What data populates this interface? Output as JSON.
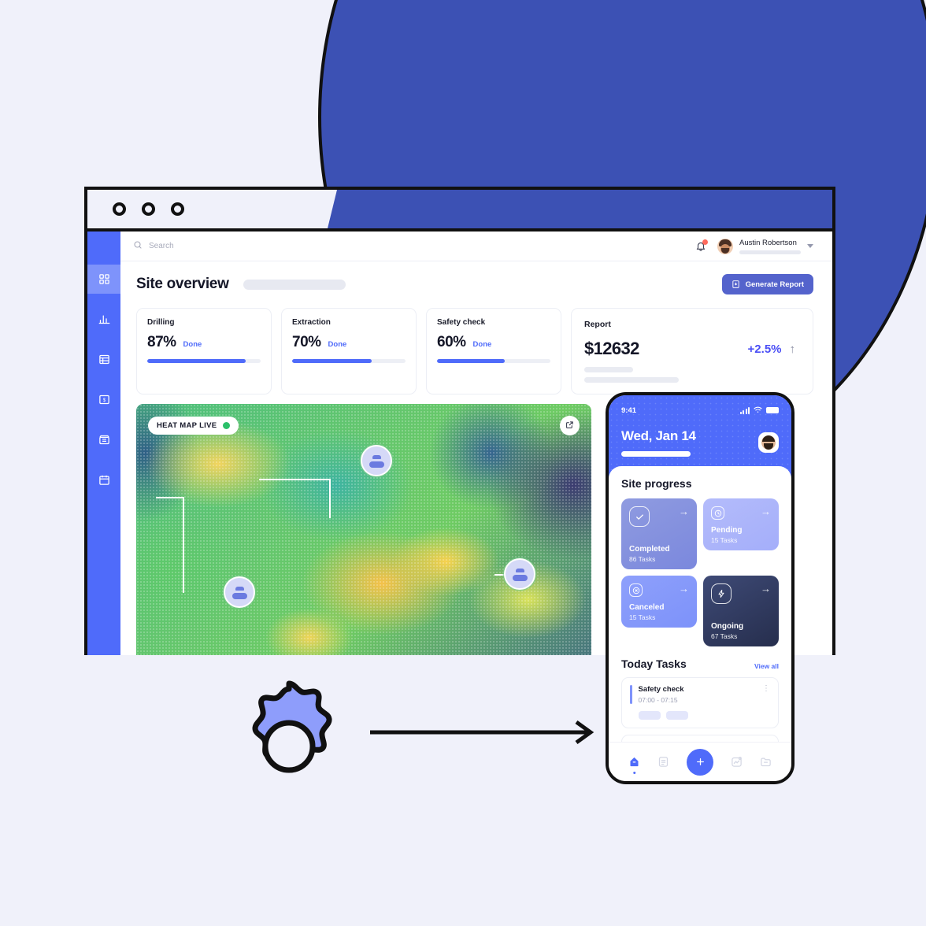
{
  "theme": {
    "brand_blue": "#4f6bfa",
    "deep_blue": "#3c51b4",
    "button_blue": "#5463cc",
    "page_bg": "#f0f1fa",
    "live_green": "#2bc06a",
    "notification_red": "#ff6b5e",
    "delta_blue": "#4a4ef5"
  },
  "browser": {
    "dots": [
      "window-dot-1",
      "window-dot-2",
      "window-dot-3"
    ]
  },
  "sidebar": {
    "items": [
      {
        "name": "dashboard",
        "icon": "grid-icon",
        "active": true
      },
      {
        "name": "analytics",
        "icon": "bar-chart-icon",
        "active": false
      },
      {
        "name": "table",
        "icon": "table-icon",
        "active": false
      },
      {
        "name": "billing",
        "icon": "money-doc-icon",
        "active": false
      },
      {
        "name": "store",
        "icon": "storefront-icon",
        "active": false
      },
      {
        "name": "calendar",
        "icon": "calendar-icon",
        "active": false
      }
    ]
  },
  "topbar": {
    "search_placeholder": "Search",
    "search_value": "",
    "search_icon": "search-icon",
    "bell_icon": "bell-icon",
    "has_notification": true,
    "user": {
      "name": "Austin Robertson",
      "avatar": "user-avatar"
    },
    "caret_icon": "chevron-down-icon"
  },
  "page": {
    "title": "Site overview",
    "generate_button": {
      "label": "Generate Report",
      "icon": "document-download-icon"
    }
  },
  "stats": [
    {
      "label": "Drilling",
      "percent": "87%",
      "status": "Done",
      "value": 87
    },
    {
      "label": "Extraction",
      "percent": "70%",
      "status": "Done",
      "value": 70
    },
    {
      "label": "Safety check",
      "percent": "60%",
      "status": "Done",
      "value": 60
    }
  ],
  "report": {
    "label": "Report",
    "amount": "$12632",
    "delta": "+2.5%",
    "trend_icon": "arrow-up-icon"
  },
  "heatmap": {
    "badge_label": "HEAT MAP LIVE",
    "live_indicator": "live-dot",
    "expand_icon": "external-link-icon",
    "markers": [
      {
        "name": "worker-marker-top",
        "icon": "person-icon"
      },
      {
        "name": "worker-marker-left",
        "icon": "person-icon"
      },
      {
        "name": "worker-marker-right",
        "icon": "person-icon"
      }
    ]
  },
  "phone": {
    "status": {
      "time": "9:41",
      "signal_icon": "cellular-signal-icon",
      "wifi_icon": "wifi-icon",
      "battery_icon": "battery-icon"
    },
    "date": "Wed, Jan 14",
    "avatar": "user-avatar",
    "progress": {
      "heading": "Site progress",
      "cards": [
        {
          "key": "completed",
          "name": "Completed",
          "tasks": "86 Tasks",
          "icon": "check-icon",
          "arrow": "arrow-right-icon"
        },
        {
          "key": "pending",
          "name": "Pending",
          "tasks": "15 Tasks",
          "icon": "clock-icon",
          "arrow": "arrow-right-icon"
        },
        {
          "key": "canceled",
          "name": "Canceled",
          "tasks": "15 Tasks",
          "icon": "x-circle-icon",
          "arrow": "arrow-right-icon"
        },
        {
          "key": "ongoing",
          "name": "Ongoing",
          "tasks": "67 Tasks",
          "icon": "bolt-icon",
          "arrow": "arrow-right-icon"
        }
      ]
    },
    "tasks": {
      "heading": "Today Tasks",
      "view_all": "View all",
      "items": [
        {
          "name": "Safety check",
          "time": "07:00 - 07:15",
          "menu_icon": "more-vertical-icon"
        }
      ]
    },
    "tabbar": {
      "items": [
        {
          "name": "home",
          "icon": "home-icon",
          "active": true
        },
        {
          "name": "tasks",
          "icon": "list-icon",
          "active": false
        },
        {
          "name": "add",
          "icon": "plus-icon",
          "active": false,
          "fab": true
        },
        {
          "name": "activity",
          "icon": "activity-icon",
          "active": false
        },
        {
          "name": "files",
          "icon": "folder-icon",
          "active": false
        }
      ]
    }
  },
  "decor": {
    "gear": "gear-icon",
    "arrow": "arrow-right-long-icon"
  }
}
